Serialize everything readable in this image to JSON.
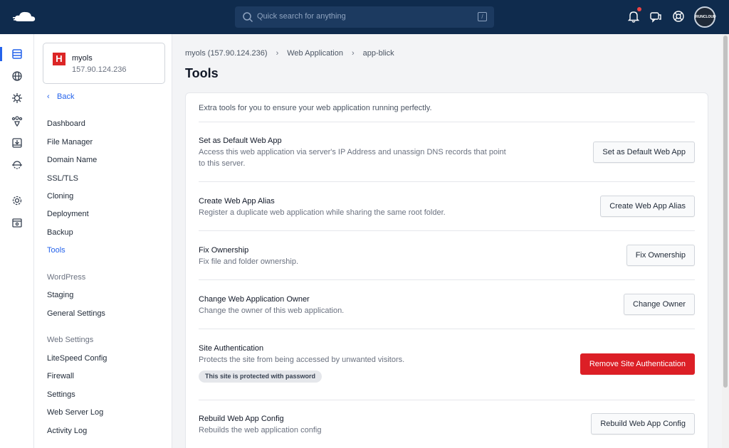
{
  "topbar": {
    "search_placeholder": "Quick search for anything",
    "search_shortcut": "/",
    "avatar_text": "RUNCLOUD",
    "icons": [
      "cloud-logo-icon",
      "search-icon",
      "bell-icon",
      "chat-icon",
      "help-icon"
    ]
  },
  "rail": {
    "icons": [
      "server-icon",
      "globe-icon",
      "bug-icon",
      "hierarchy-icon",
      "download-box-icon",
      "cloud-sync-icon",
      "settings-gear-icon",
      "archive-icon"
    ]
  },
  "sidebar": {
    "server_name": "myols",
    "server_ip": "157.90.124.236",
    "server_logo_letter": "H",
    "back_label": "Back",
    "items": [
      {
        "label": "Dashboard"
      },
      {
        "label": "File Manager"
      },
      {
        "label": "Domain Name"
      },
      {
        "label": "SSL/TLS"
      },
      {
        "label": "Cloning"
      },
      {
        "label": "Deployment"
      },
      {
        "label": "Backup"
      },
      {
        "label": "Tools",
        "active": true
      }
    ],
    "wordpress_header": "WordPress",
    "wordpress_items": [
      {
        "label": "Staging"
      },
      {
        "label": "General Settings"
      }
    ],
    "web_settings_header": "Web Settings",
    "web_settings_items": [
      {
        "label": "LiteSpeed Config"
      },
      {
        "label": "Firewall"
      },
      {
        "label": "Settings"
      },
      {
        "label": "Web Server Log"
      },
      {
        "label": "Activity Log"
      }
    ]
  },
  "main": {
    "breadcrumb": [
      "myols (157.90.124.236)",
      "Web Application",
      "app-blick"
    ],
    "title": "Tools",
    "intro": "Extra tools for you to ensure your web application running perfectly.",
    "tools": [
      {
        "title": "Set as Default Web App",
        "desc": "Access this web application via server's IP Address and unassign DNS records that point to this server.",
        "button": "Set as Default Web App"
      },
      {
        "title": "Create Web App Alias",
        "desc": "Register a duplicate web application while sharing the same root folder.",
        "button": "Create Web App Alias"
      },
      {
        "title": "Fix Ownership",
        "desc": "Fix file and folder ownership.",
        "button": "Fix Ownership"
      },
      {
        "title": "Change Web Application Owner",
        "desc": "Change the owner of this web application.",
        "button": "Change Owner"
      },
      {
        "title": "Site Authentication",
        "desc": "Protects the site from being accessed by unwanted visitors.",
        "button": "Remove Site Authentication",
        "badge": "This site is protected with password"
      },
      {
        "title": "Rebuild Web App Config",
        "desc": "Rebuilds the web application config",
        "button": "Rebuild Web App Config"
      }
    ]
  },
  "colors": {
    "topbar": "#0f2b4d",
    "accent": "#2563eb",
    "danger": "#dc1f26"
  }
}
